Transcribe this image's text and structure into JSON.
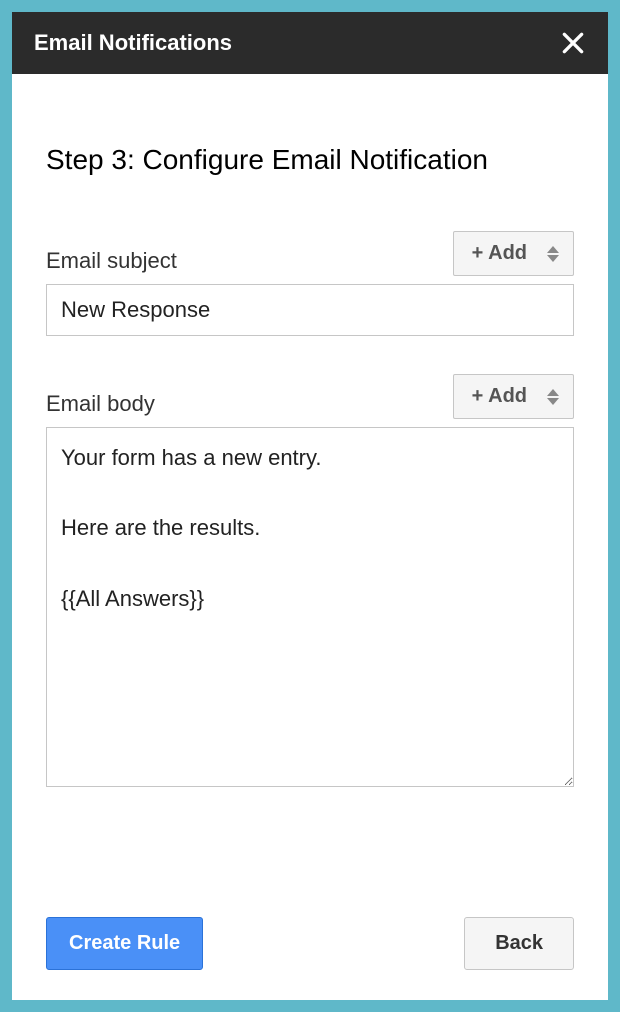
{
  "header": {
    "title": "Email Notifications"
  },
  "step": {
    "title": "Step 3: Configure Email Notification"
  },
  "subject": {
    "label": "Email subject",
    "add_label": "+ Add",
    "value": "New Response"
  },
  "body": {
    "label": "Email body",
    "add_label": "+ Add",
    "value": "Your form has a new entry.\n\nHere are the results.\n\n{{All Answers}}"
  },
  "buttons": {
    "create": "Create Rule",
    "back": "Back"
  }
}
